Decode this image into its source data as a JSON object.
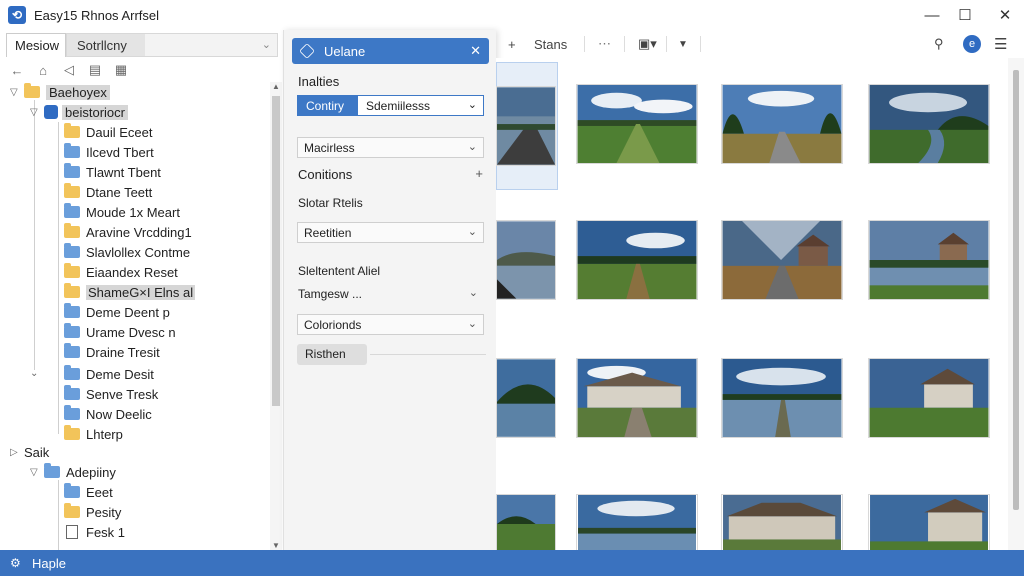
{
  "window": {
    "title": "Easy15 Rhnos Arrfsel",
    "app_icon": "app-logo-icon",
    "controls": [
      "minimize-icon",
      "maximize-icon",
      "close-icon"
    ]
  },
  "left": {
    "tab_active": "Mesiow",
    "tab_combo": "Sotrllcny",
    "nav_icons": [
      "back-arrow-icon",
      "home-icon",
      "forward-arrow-icon",
      "view-icon",
      "layout-icon"
    ],
    "tree": [
      {
        "label": "Baehoyex",
        "level": 0,
        "icon": "folder",
        "expanded": true,
        "selected": false
      },
      {
        "label": "beistoriocr",
        "level": 1,
        "icon": "drive",
        "expanded": true,
        "selected": true
      },
      {
        "label": "Dauil Eceet",
        "level": 2,
        "icon": "folder"
      },
      {
        "label": "Ilcevd Tbert",
        "level": 2,
        "icon": "folder"
      },
      {
        "label": "Tlawnt Tbent",
        "level": 2,
        "icon": "folder"
      },
      {
        "label": "Dtane Teett",
        "level": 2,
        "icon": "folder"
      },
      {
        "label": "Moude 1x Meart",
        "level": 2,
        "icon": "folder"
      },
      {
        "label": "Aravine Vrcdding1",
        "level": 2,
        "icon": "folder"
      },
      {
        "label": "Slavlollex Contme",
        "level": 2,
        "icon": "folder"
      },
      {
        "label": "Eiaandex Reset",
        "level": 2,
        "icon": "folder"
      },
      {
        "label": "ShameG×I Elns al",
        "level": 2,
        "icon": "folder"
      },
      {
        "label": "Deme Deent p",
        "level": 2,
        "icon": "folder"
      },
      {
        "label": "Urame Dvesc n",
        "level": 2,
        "icon": "folder"
      },
      {
        "label": "Draine Tresit",
        "level": 2,
        "icon": "folder"
      },
      {
        "label": "Deme Desit",
        "level": 2,
        "icon": "folder"
      },
      {
        "label": "Senve Tresk",
        "level": 2,
        "icon": "folder"
      },
      {
        "label": "Now Deelic",
        "level": 2,
        "icon": "folder"
      },
      {
        "label": "Lhterp",
        "level": 2,
        "icon": "folder"
      },
      {
        "label": "Saik",
        "level": 0,
        "icon": "none",
        "expanded": false
      },
      {
        "label": "Adepiiny",
        "level": 0,
        "icon": "folder",
        "expanded": true
      },
      {
        "label": "Eeet",
        "level": 2,
        "icon": "folder"
      },
      {
        "label": "Pesity",
        "level": 2,
        "icon": "folder"
      },
      {
        "label": "Fesk 1",
        "level": 2,
        "icon": "doc"
      }
    ]
  },
  "panel": {
    "title": "Uelane",
    "section1": "Inalties",
    "seg_on": "Contiry",
    "seg_off": "Sdemiilesss",
    "dropdown1": "Macirless",
    "conditions": "Conitions",
    "section2": "Slotar Rtelis",
    "dropdown2": "Reetitien",
    "section3": "Sleltentent Aliel",
    "dropdown3": "Tamgesw ...",
    "dropdown4": "Colorionds",
    "button": "Risthen"
  },
  "toolbar": {
    "add_label": "Stans",
    "icons": [
      "plus-icon",
      "dots-icon",
      "view-mode-icon",
      "chevron-down-icon",
      "pin-icon",
      "profile-icon",
      "menu-icon"
    ]
  },
  "gallery": {
    "items": [
      {
        "scene": "road-field-water"
      },
      {
        "scene": "field-sky"
      },
      {
        "scene": "road-trees"
      },
      {
        "scene": "river-trees"
      },
      {
        "scene": "lake-hills"
      },
      {
        "scene": "farm-field"
      },
      {
        "scene": "road-house"
      },
      {
        "scene": "river-house"
      },
      {
        "scene": "lake-forest"
      },
      {
        "scene": "farmhouse"
      },
      {
        "scene": "lake-reeds"
      },
      {
        "scene": "stone-house"
      },
      {
        "scene": "field-partial"
      },
      {
        "scene": "lake-sky"
      },
      {
        "scene": "houses-row"
      },
      {
        "scene": "stone-building"
      }
    ]
  },
  "status": {
    "text": "Haple"
  },
  "colors": {
    "accent": "#3d78c6",
    "status_bar": "#3a72bf",
    "selection": "#e6eef8"
  }
}
